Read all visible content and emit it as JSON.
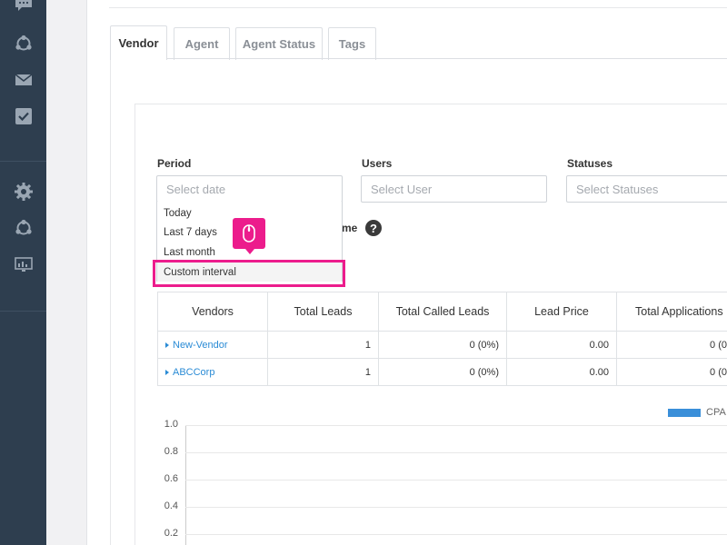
{
  "sidebar": {
    "icons": [
      "chat-icon",
      "share-icon",
      "mail-icon",
      "check-badge-icon",
      "gear-icon",
      "share-icon",
      "monitor-chart-icon"
    ]
  },
  "tabs": [
    {
      "label": "Vendor",
      "active": true
    },
    {
      "label": "Agent",
      "active": false
    },
    {
      "label": "Agent Status",
      "active": false
    },
    {
      "label": "Tags",
      "active": false
    }
  ],
  "filters": {
    "period": {
      "label": "Period",
      "placeholder": "Select date"
    },
    "users": {
      "label": "Users",
      "placeholder": "Select User"
    },
    "statuses": {
      "label": "Statuses",
      "placeholder": "Select Statuses"
    }
  },
  "period_dropdown": {
    "options": [
      "Today",
      "Last 7 days",
      "Last month",
      "Custom interval"
    ],
    "highlighted": "Custom interval"
  },
  "partial_label": "me",
  "help_icon": "question-circle-icon",
  "annotation": {
    "icon": "mouse-icon",
    "color": "#ec1c8c"
  },
  "table": {
    "headers": [
      "Vendors",
      "Total Leads",
      "Total Called Leads",
      "Lead Price",
      "Total Applications"
    ],
    "rows": [
      {
        "vendor": "New-Vendor",
        "total_leads": "1",
        "total_called": "0 (0%)",
        "lead_price": "0.00",
        "total_apps": "0 (0"
      },
      {
        "vendor": "ABCCorp",
        "total_leads": "1",
        "total_called": "0 (0%)",
        "lead_price": "0.00",
        "total_apps": "0 (0"
      }
    ]
  },
  "chart_data": {
    "type": "bar",
    "series": [
      {
        "name": "CPA (Cost Per Ap",
        "values": []
      }
    ],
    "ylim": [
      0,
      1.0
    ],
    "y_ticks": [
      "1.0",
      "0.8",
      "0.6",
      "0.4",
      "0.2"
    ],
    "legend_position": "top-right",
    "grid": true,
    "color": "#3a8fd9"
  },
  "colors": {
    "sidebar": "#2e3e4f",
    "accent_pink": "#ec1c8c",
    "link": "#2a8bd5"
  }
}
